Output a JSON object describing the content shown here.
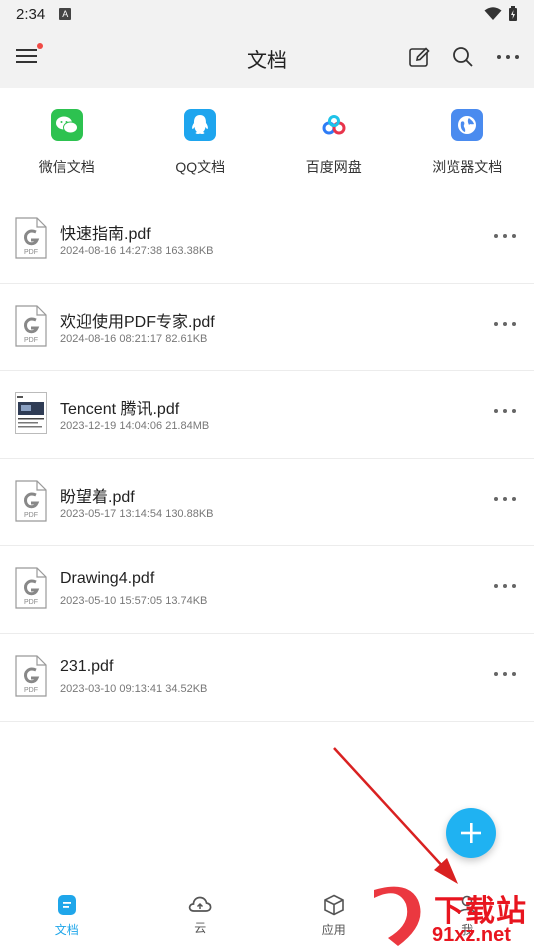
{
  "status_bar": {
    "time": "2:34",
    "notification_icon": "A"
  },
  "app_bar": {
    "title": "文档",
    "menu_badge_color": "#f04a45"
  },
  "shortcuts": [
    {
      "label": "微信文档",
      "icon": "wechat-icon",
      "color": "#2dc250"
    },
    {
      "label": "QQ文档",
      "icon": "qq-icon",
      "color": "#1ea5ee"
    },
    {
      "label": "百度网盘",
      "icon": "baidu-netdisk-icon",
      "color": "#2e7cf6"
    },
    {
      "label": "浏览器文档",
      "icon": "browser-icon",
      "color": "#4a8bef"
    }
  ],
  "files": [
    {
      "name": "快速指南.pdf",
      "meta": "2024-08-16 14:27:38 163.38KB",
      "thumb": "pdf"
    },
    {
      "name": "欢迎使用PDF专家.pdf",
      "meta": "2024-08-16 08:21:17 82.61KB",
      "thumb": "pdf"
    },
    {
      "name": "Tencent 腾讯.pdf",
      "meta": "2023-12-19 14:04:06 21.84MB",
      "thumb": "preview"
    },
    {
      "name": "盼望着.pdf",
      "meta": "2023-05-17 13:14:54 130.88KB",
      "thumb": "pdf"
    },
    {
      "name": "Drawing4.pdf",
      "meta": "2023-05-10 15:57:05 13.74KB",
      "thumb": "pdf"
    },
    {
      "name": "231.pdf",
      "meta": "2023-03-10 09:13:41 34.52KB",
      "thumb": "pdf"
    }
  ],
  "pdf_thumb_label": "PDF",
  "bottom_nav": [
    {
      "label": "文档",
      "icon": "document-icon",
      "active": true
    },
    {
      "label": "云",
      "icon": "cloud-icon",
      "active": false
    },
    {
      "label": "应用",
      "icon": "box-icon",
      "active": false
    },
    {
      "label": "我",
      "icon": "person-icon",
      "active": false
    }
  ],
  "watermark": {
    "text": "下载站",
    "url": "91xz.net"
  },
  "colors": {
    "accent": "#1fb2f2",
    "annotation_arrow": "#d92121"
  }
}
